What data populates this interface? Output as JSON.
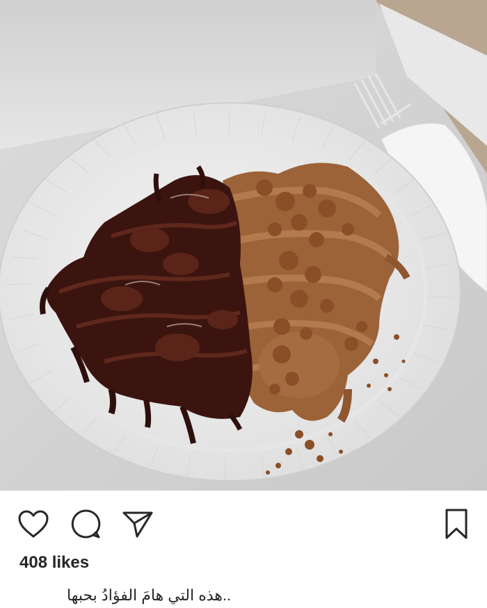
{
  "post": {
    "image_description_icon": "dessert-photo",
    "likes_text": "408 likes",
    "caption": "..هذه التي هامَ الفؤادُ بحبها"
  },
  "actions": {
    "like_icon": "heart-icon",
    "comment_icon": "comment-icon",
    "share_icon": "send-icon",
    "save_icon": "bookmark-icon"
  },
  "colors": {
    "text": "#262626",
    "chocolate": "#3b1410",
    "caramel": "#a0673d"
  }
}
